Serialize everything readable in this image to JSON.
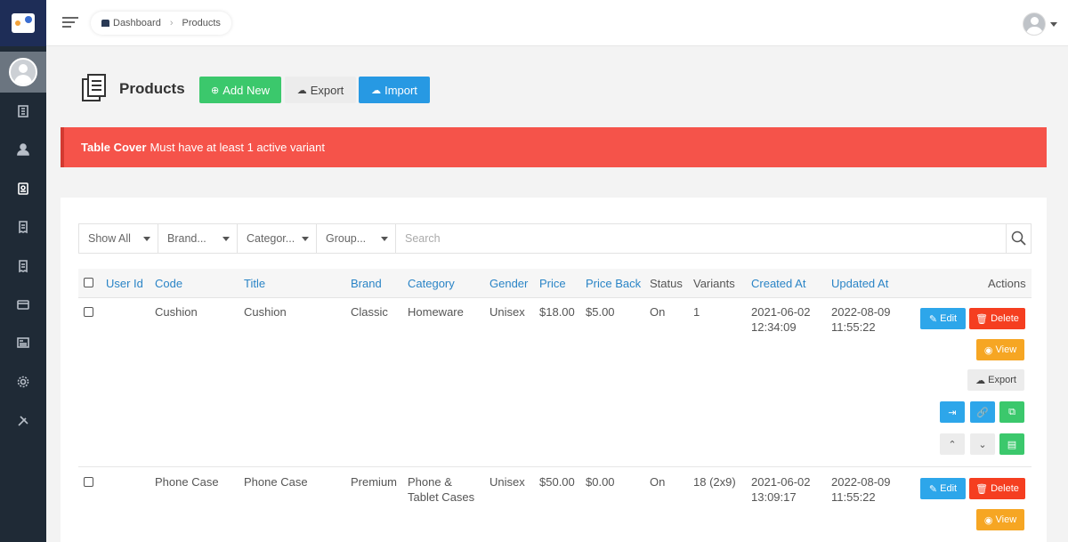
{
  "app": {
    "breadcrumb": {
      "home": "Dashboard",
      "current": "Products"
    }
  },
  "page": {
    "title": "Products",
    "add_label": "Add New",
    "export_label": "Export",
    "import_label": "Import"
  },
  "alert": {
    "bold": "Table Cover",
    "text": "Must have at least 1 active variant"
  },
  "filters": {
    "show": "Show All",
    "brand": "Brand...",
    "category": "Categor...",
    "group": "Group...",
    "search_placeholder": "Search"
  },
  "table": {
    "columns": {
      "user_id": "User Id",
      "code": "Code",
      "title": "Title",
      "brand": "Brand",
      "category": "Category",
      "gender": "Gender",
      "price": "Price",
      "price_back": "Price Back",
      "status": "Status",
      "variants": "Variants",
      "created_at": "Created At",
      "updated_at": "Updated At",
      "actions": "Actions"
    },
    "rows": [
      {
        "code": "Cushion",
        "title": "Cushion",
        "brand": "Classic",
        "category_l1": "Homeware",
        "category_l2": "",
        "gender": "Unisex",
        "price": "$18.00",
        "price_back": "$5.00",
        "status": "On",
        "variants": "1",
        "created_date": "2021-06-02",
        "created_time": "12:34:09",
        "updated_date": "2022-08-09",
        "updated_time": "11:55:22"
      },
      {
        "code": "Phone Case",
        "title": "Phone Case",
        "brand": "Premium",
        "category_l1": "Phone &",
        "category_l2": "Tablet Cases",
        "gender": "Unisex",
        "price": "$50.00",
        "price_back": "$0.00",
        "status": "On",
        "variants": "18 (2x9)",
        "created_date": "2021-06-02",
        "created_time": "13:09:17",
        "updated_date": "2022-08-09",
        "updated_time": "11:55:22"
      }
    ],
    "action_labels": {
      "edit": "Edit",
      "delete": "Delete",
      "view": "View",
      "export": "Export"
    }
  }
}
